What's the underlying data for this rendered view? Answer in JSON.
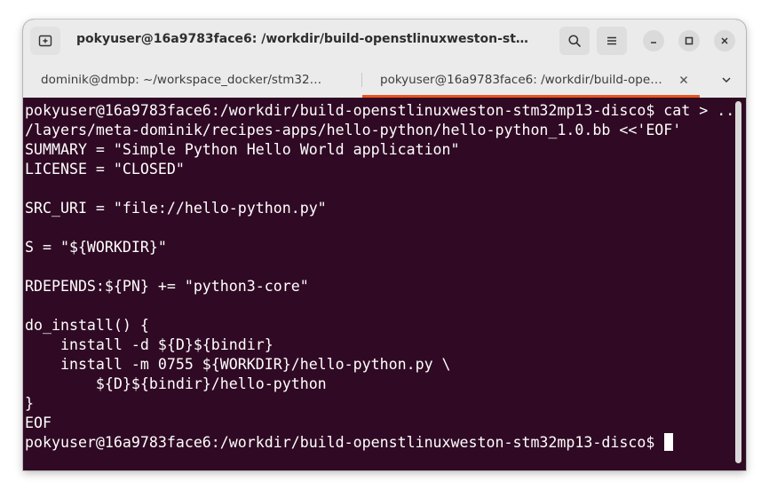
{
  "window": {
    "title": "pokyuser@16a9783face6: /workdir/build-openstlinuxweston-stm32mp13-disco"
  },
  "tabs": [
    {
      "label": "dominik@dmbp: ~/workspace_docker/stm32mp13-disco",
      "active": false
    },
    {
      "label": "pokyuser@16a9783face6: /workdir/build-openstlinuxweston-stm32mp13-disco",
      "active": true
    }
  ],
  "terminal": {
    "background": "#300a24",
    "foreground": "#ffffff",
    "lines": [
      "pokyuser@16a9783face6:/workdir/build-openstlinuxweston-stm32mp13-disco$ cat > ..",
      "/layers/meta-dominik/recipes-apps/hello-python/hello-python_1.0.bb <<'EOF'",
      "SUMMARY = \"Simple Python Hello World application\"",
      "LICENSE = \"CLOSED\"",
      "",
      "SRC_URI = \"file://hello-python.py\"",
      "",
      "S = \"${WORKDIR}\"",
      "",
      "RDEPENDS:${PN} += \"python3-core\"",
      "",
      "do_install() {",
      "    install -d ${D}${bindir}",
      "    install -m 0755 ${WORKDIR}/hello-python.py \\",
      "        ${D}${bindir}/hello-python",
      "}",
      "EOF"
    ],
    "prompt": "pokyuser@16a9783face6:/workdir/build-openstlinuxweston-stm32mp13-disco$ "
  },
  "colors": {
    "accent": "#e95420",
    "titlebar": "#ebebeb"
  },
  "icons": {
    "new_tab": "new-tab-icon",
    "search": "search-icon",
    "menu": "hamburger-menu-icon",
    "minimize": "minimize-icon",
    "maximize": "maximize-icon",
    "close": "close-icon",
    "tab_close": "tab-close-icon",
    "dropdown": "chevron-down-icon"
  }
}
